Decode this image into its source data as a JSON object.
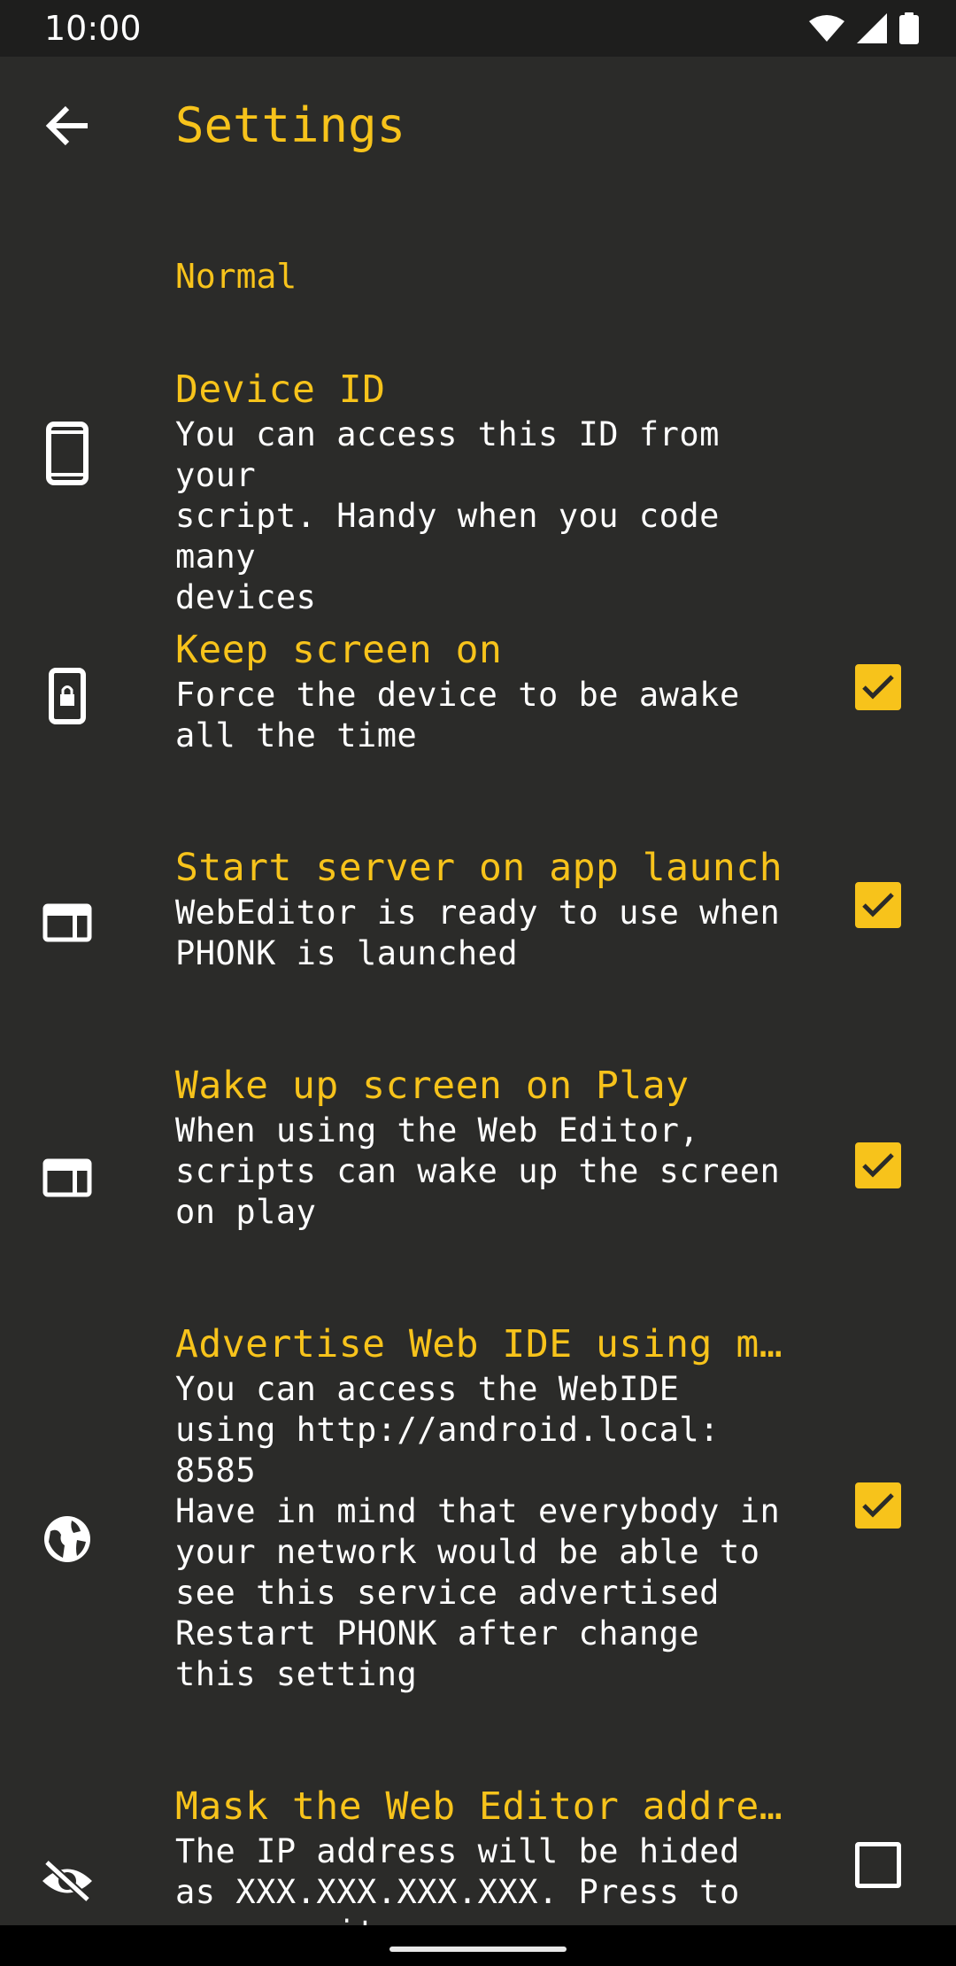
{
  "status_bar": {
    "time": "10:00",
    "icons": [
      "wifi-icon",
      "signal-icon",
      "battery-icon"
    ]
  },
  "toolbar": {
    "title": "Settings",
    "back_icon": "arrow-back-icon"
  },
  "category": {
    "label": "Normal"
  },
  "preferences": [
    {
      "title": "Device ID",
      "summary": "You can access this ID from your\nscript. Handy when you code many\ndevices",
      "icon": "smartphone-icon",
      "checkbox": null
    },
    {
      "title": "Keep screen on",
      "summary": "Force the device to be awake\nall the time",
      "icon": "screen-lock-icon",
      "checkbox": true
    },
    {
      "title": "Start server on app launch",
      "summary": "WebEditor is ready to use when\nPHONK is launched",
      "icon": "web-window-icon",
      "checkbox": true
    },
    {
      "title": "Wake up screen on Play",
      "summary": "When using the Web Editor,\nscripts can wake up the screen\non play",
      "icon": "web-window-icon",
      "checkbox": true
    },
    {
      "title": "Advertise Web IDE using mD…",
      "summary": "You can access the WebIDE\nusing http://android.local:\n8585\nHave in mind that everybody in\nyour network would be able to\nsee this service advertised\nRestart PHONK after change\nthis setting",
      "icon": "globe-icon",
      "checkbox": true
    },
    {
      "title": "Mask the Web Editor address",
      "summary": "The IP address will be hided\nas XXX.XXX.XXX.XXX. Press to\nuncover it",
      "icon": "visibility-off-icon",
      "checkbox": false
    }
  ],
  "colors": {
    "accent": "#f7c31b",
    "background": "#2b2b29",
    "status_bar": "#1e1e1d",
    "text": "#ffffff"
  }
}
